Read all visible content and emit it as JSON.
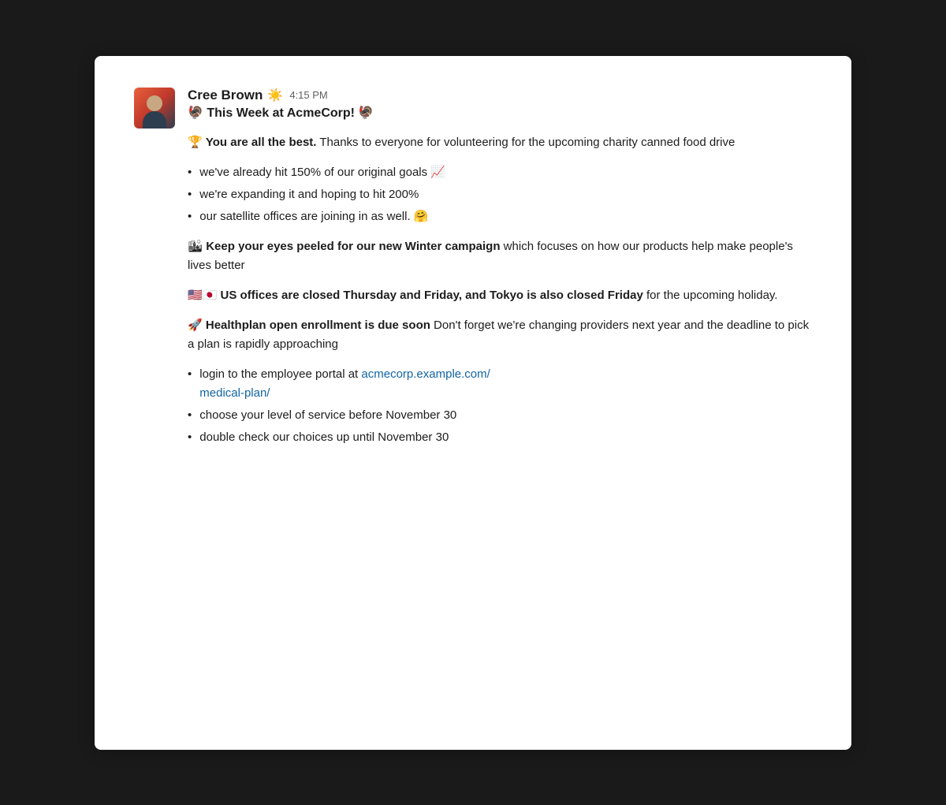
{
  "background": "#1a1a1a",
  "card": {
    "background": "#ffffff"
  },
  "author": {
    "name": "Cree Brown",
    "sun_emoji": "☀️",
    "timestamp": "4:15 PM"
  },
  "post_title": "🦃 This Week at AcmeCorp! 🦃",
  "sections": [
    {
      "id": "best",
      "emoji": "🏆",
      "bold_text": "You are all the best.",
      "normal_text": " Thanks to everyone for volunteering for the upcoming charity canned food drive"
    },
    {
      "id": "bullets1",
      "items": [
        "we've already hit 150% of our original goals 📈",
        "we're expanding it and hoping to hit 200%",
        "our satellite offices are joining in as well. 🤗"
      ]
    },
    {
      "id": "winter",
      "emoji": "🏙",
      "bold_text": "Keep your eyes peeled for our new Winter campaign",
      "normal_text": " which focuses on how our products help make people's lives better"
    },
    {
      "id": "offices",
      "emoji": "🇺🇸🇯🇵",
      "bold_text": "US offices are closed Thursday and Friday, and Tokyo is also closed Friday",
      "normal_text": " for the upcoming holiday."
    },
    {
      "id": "healthplan",
      "emoji": "🚀",
      "bold_text": "Healthplan open enrollment is due soon",
      "normal_text": " Don't forget we're changing providers next year and the deadline to pick a plan is rapidly approaching"
    },
    {
      "id": "bullets2",
      "items_with_link": [
        {
          "text_before": "login to the employee portal at ",
          "link_text": "acmecorp.example.com/\nmedical-plan/",
          "link_href": "http://acmecorp.example.com/medical-plan/",
          "text_after": ""
        }
      ],
      "items": [
        "choose your level of service before November 30",
        "double check our choices up until November 30"
      ]
    }
  ],
  "link": {
    "text": "acmecorp.example.com/\nmedical-plan/",
    "href": "http://acmecorp.example.com/medical-plan/",
    "color": "#1264a3"
  }
}
